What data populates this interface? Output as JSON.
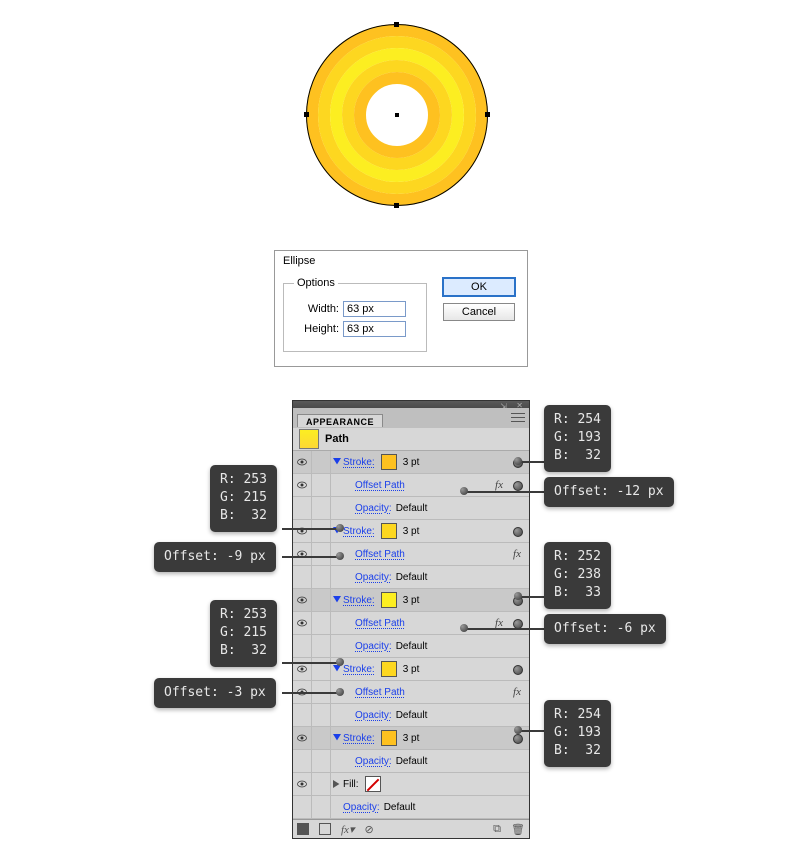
{
  "artwork": {
    "rings": [
      {
        "color": "#fec120",
        "inset": 9,
        "width": 12
      },
      {
        "color": "#fdd720",
        "inset": 21,
        "width": 12
      },
      {
        "color": "#fcee21",
        "inset": 33,
        "width": 12
      },
      {
        "color": "#fdd720",
        "inset": 45,
        "width": 12
      },
      {
        "color": "#fec120",
        "inset": 57,
        "width": 12
      }
    ]
  },
  "dialog": {
    "title": "Ellipse",
    "legend": "Options",
    "width_label": "Width:",
    "width_value": "63 px",
    "height_label": "Height:",
    "height_value": "63 px",
    "ok": "OK",
    "cancel": "Cancel"
  },
  "panel": {
    "title": "APPEARANCE",
    "path_label": "Path",
    "stroke_label": "Stroke:",
    "offset_label": "Offset Path",
    "opacity_label": "Opacity:",
    "opacity_value": "Default",
    "fill_label": "Fill:",
    "fx_label": "fx",
    "strokes": [
      {
        "color": "#fec120",
        "pt": "3 pt"
      },
      {
        "color": "#fdd720",
        "pt": "3 pt"
      },
      {
        "color": "#fcee21",
        "pt": "3 pt"
      },
      {
        "color": "#fdd720",
        "pt": "3 pt"
      },
      {
        "color": "#fec120",
        "pt": "3 pt"
      }
    ],
    "footer_fx": "fx▾"
  },
  "callouts": {
    "c1": "R: 254\nG: 193\nB:  32",
    "c2": "Offset: -12 px",
    "c3": "R: 253\nG: 215\nB:  32",
    "c4": "Offset: -9 px",
    "c5": "R: 252\nG: 238\nB:  33",
    "c6": "Offset: -6 px",
    "c7": "R: 253\nG: 215\nB:  32",
    "c8": "Offset: -3 px",
    "c9": "R: 254\nG: 193\nB:  32"
  }
}
